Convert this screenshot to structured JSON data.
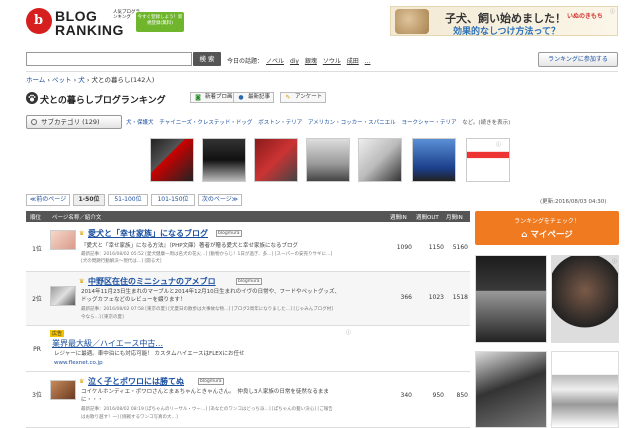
{
  "header": {
    "logo_letter": "b",
    "logo_line1": "BLOG",
    "logo_line2": "RANKING",
    "logo_tagline": "人気ブログランキング",
    "register_badge": "今すぐ登録しよう！新規登録(無料)",
    "top_ad": {
      "headline": "子犬、飼い始めました！",
      "subline": "効果的なしつけ方法って？",
      "brand": "いぬのきもち"
    }
  },
  "search": {
    "placeholder": "",
    "button_label": "検 索",
    "topics_label": "今日の話題：",
    "topics": [
      "ノベル",
      "diy",
      "銀塊",
      "ソウル",
      "成田",
      "..."
    ],
    "join_button": "ランキングに参加する"
  },
  "breadcrumb": {
    "items": [
      "ホーム",
      "ペット",
      "犬"
    ],
    "current": "犬との暮らし",
    "count": "(142人)"
  },
  "title": {
    "text": "犬との暮らしブログランキング",
    "buttons": [
      "新着ブロ画",
      "最新記事",
      "アンケート"
    ]
  },
  "subcategory": {
    "button_label": "サブカテゴリ (129)",
    "links": [
      "犬・保護犬",
      "チャイニーズ・クレステッド・ドッグ",
      "ボストン・テリア",
      "アメリカン・コッカー・スパニエル",
      "ヨークシャー・テリア"
    ],
    "suffix": "など。(続きを表示)"
  },
  "pagination": {
    "prev": "≪前のページ",
    "pages": [
      "1-50位",
      "51-100位",
      "101-150位"
    ],
    "next": "次のページ≫",
    "updated": "(更新:2016/08/03 04:30)"
  },
  "table": {
    "headers": {
      "rank": "順位",
      "name": "ページ名称／紹介文",
      "in": "週間IN",
      "out": "週間OUT",
      "month": "月間IN"
    },
    "rows": [
      {
        "rank": "1位",
        "title": "愛犬と「幸せ家族」になるブログ",
        "badge": "blogmura",
        "desc": "『愛犬と「幸せ家族」になる方法』（PHP文庫）著者が贈る愛犬と幸せ家族になるブログ",
        "meta1": "最新記事：2016/08/02 05:52 [愛犬健康一周は名犬の花火…] [動物からじ！1日が過ぎ、多…] [スーパーの安売りサギに…]",
        "meta2": "[犬の問題行動解決〜現代は…] [闘る犬]",
        "in": "1090",
        "out": "1150",
        "month": "5160"
      },
      {
        "rank": "2位",
        "title": "中野区在住のミニシュナのアメブロ",
        "badge": "blogmura",
        "desc": "2014年11月23日生まれのマーブルと2014年12月10日生まれのイヴの日常や、フードやペットグッズ、",
        "desc2": "ドッグカフェなどのレビューを綴ります！",
        "meta1": "最新記事：2016/08/02 07:58 [東京の夏] [元夏日の散歩は大事故な物…] [ブログ2周年になりました…] [じゃみんブログ村]",
        "meta2": "今なら…] [東京の夏]",
        "in": "366",
        "out": "1023",
        "month": "1518"
      },
      {
        "rank": "3位",
        "title": "泣く子とポワロには勝てぬ",
        "badge": "blogmura",
        "desc": "コイケルホンディエ・ポワロさんとまぁちゃんときゃんさん。　仲良し3人家族の日常を徒然なるまま",
        "desc2": "に・・・",
        "meta1": "最新記事：2016/08/02 08:19 [ぽちゃんのリーサル・ウー…] [あなたのワンコはどっち派…] [ぽちゃんの髪い決心] [ご報告",
        "meta2": "はお散り越す！一] [挑戦するワンコ写真の大…]",
        "in": "340",
        "out": "950",
        "month": "850"
      }
    ],
    "pr_row": {
      "rank": "PR",
      "tag": "広告",
      "title": "業界最大級／ハイエース中古...",
      "desc": "レジャーに最適。車中泊にも対応可能！ カスタムハイエースはFLEXにお任せ",
      "url": "www.flexnet.co.jp"
    }
  },
  "sidebar": {
    "rank_check": "ランキングをチェック！",
    "mypage": "マイページ"
  },
  "colors": {
    "brand_red": "#d61f1f",
    "link_blue": "#1a4fa0",
    "header_gray": "#555555",
    "orange": "#f07a20",
    "register_green": "#6fb62c"
  }
}
